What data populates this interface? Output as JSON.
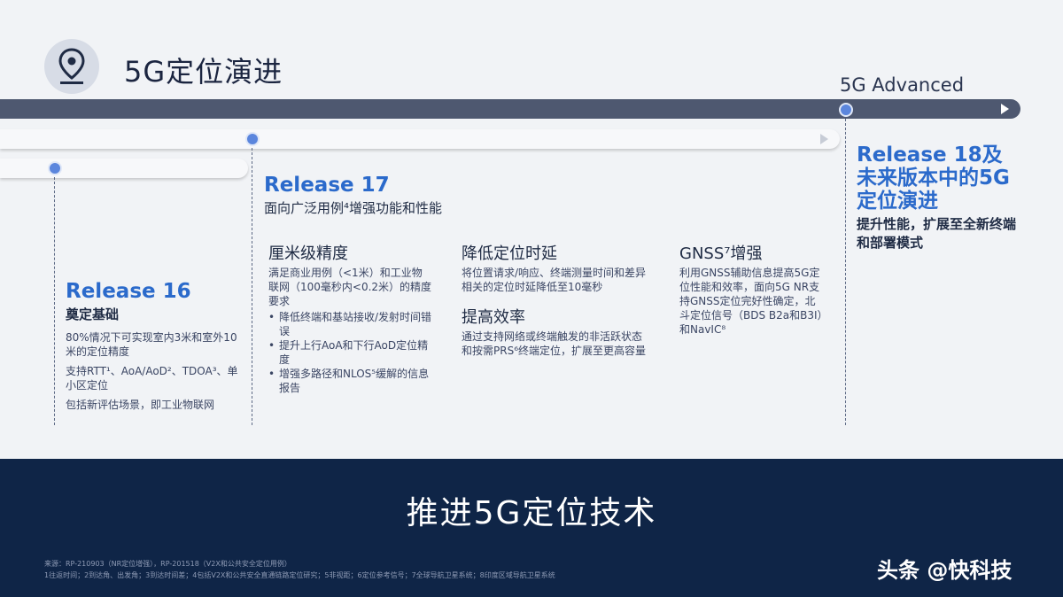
{
  "header": {
    "title": "5G定位演进",
    "advanced_label": "5G Advanced"
  },
  "r16": {
    "title": "Release 16",
    "subtitle": "奠定基础",
    "lines": [
      "80%情况下可实现室内3米和室外10米的定位精度",
      "支持RTT¹、AoA/AoD²、TDOA³、单小区定位",
      "包括新评估场景，即工业物联网"
    ]
  },
  "r17": {
    "title": "Release 17",
    "subtitle": "面向广泛用例⁴增强功能和性能",
    "col1": {
      "heading": "厘米级精度",
      "desc": "满足商业用例（<1米）和工业物联网（100毫秒内<0.2米）的精度要求",
      "points": [
        "降低终端和基站接收/发射时间错误",
        "提升上行AoA和下行AoD定位精度",
        "增强多路径和NLOS⁵缓解的信息报告"
      ]
    },
    "col2": {
      "heading": "降低定位时延",
      "desc": "将位置请求/响应、终端测量时间和差异相关的定位时延降低至10毫秒",
      "heading2": "提高效率",
      "desc2": "通过支持网络或终端触发的非活跃状态和按需PRS⁶终端定位，扩展至更高容量"
    },
    "col3": {
      "heading": "GNSS⁷增强",
      "desc": "利用GNSS辅助信息提高5G定位性能和效率，面向5G NR支持GNSS定位完好性确定，北斗定位信号（BDS B2a和B3I）和NavIC⁸"
    }
  },
  "r18": {
    "title": "Release 18及未来版本中的5G定位演进",
    "desc": "提升性能，扩展至全新终端和部署模式"
  },
  "footer": {
    "slogan": "推进5G定位技术",
    "source": "来源：RP-210903（NR定位增强），RP-201518（V2X和公共安全定位用例）",
    "notes": "1往返时间；2到达角、出发角；3到达时间差；4包括V2X和公共安全直通链路定位研究；5非视距；6定位参考信号；7全球导航卫星系统；8印度区域导航卫星系统",
    "watermark": "头条 @快科技"
  },
  "colors": {
    "accent_blue": "#2b6acb",
    "timeline_dark": "#4e5870",
    "footer_bg": "#0f2547"
  }
}
